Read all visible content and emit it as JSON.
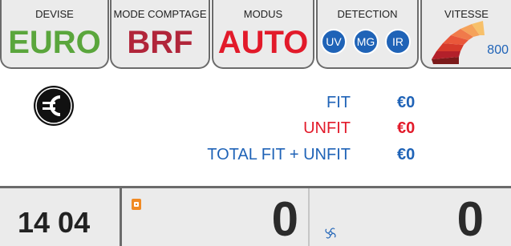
{
  "header": {
    "devise": {
      "label": "DEVISE",
      "value": "EURO",
      "color": "#5aa63c"
    },
    "mode_comptage": {
      "label": "MODE COMPTAGE",
      "value": "BRF",
      "color": "#b1253a"
    },
    "modus": {
      "label": "MODUS",
      "value": "AUTO",
      "color": "#e21a2a"
    },
    "detection": {
      "label": "DETECTION",
      "badges": [
        "UV",
        "MG",
        "IR"
      ],
      "badge_color": "#1f63b7"
    },
    "vitesse": {
      "label": "VITESSE",
      "value": "800",
      "icon": "speed-gauge-icon"
    }
  },
  "main": {
    "currency_icon": "euro-icon",
    "rows": [
      {
        "label": "FIT",
        "value": "€0",
        "label_color": "#1f63b7",
        "value_color": "#1f63b7"
      },
      {
        "label": "UNFIT",
        "value": "€0",
        "label_color": "#e21a2a",
        "value_color": "#e21a2a"
      },
      {
        "label": "TOTAL FIT + UNFIT",
        "value": "€0",
        "label_color": "#1f63b7",
        "value_color": "#1f63b7"
      }
    ]
  },
  "footer": {
    "date": "14 04",
    "count_a": "0",
    "count_a_icon": "pouch-icon",
    "count_b": "0",
    "count_b_icon": "fan-icon"
  }
}
